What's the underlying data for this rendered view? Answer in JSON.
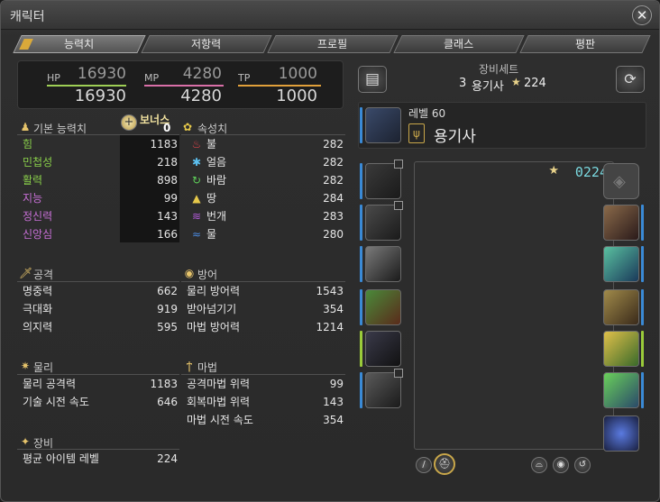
{
  "window": {
    "title": "캐릭터"
  },
  "tabs": [
    {
      "label": "능력치",
      "active": true
    },
    {
      "label": "저항력"
    },
    {
      "label": "프로필"
    },
    {
      "label": "클래스"
    },
    {
      "label": "평판"
    }
  ],
  "vitals": {
    "hp": {
      "label": "HP",
      "max": "16930",
      "current": "16930",
      "color": "#9ecf55"
    },
    "mp": {
      "label": "MP",
      "max": "4280",
      "current": "4280",
      "color": "#d96fa8"
    },
    "tp": {
      "label": "TP",
      "max": "1000",
      "current": "1000",
      "color": "#e1a03a"
    }
  },
  "base_stats": {
    "header": "기본 능력치",
    "bonus_label": "보너스",
    "bonus_value": "0",
    "items": [
      {
        "label": "힘",
        "value": "1183",
        "color": "#8ad04a"
      },
      {
        "label": "민첩성",
        "value": "218",
        "color": "#8ad04a"
      },
      {
        "label": "활력",
        "value": "898",
        "color": "#8ad04a"
      },
      {
        "label": "지능",
        "value": "99",
        "color": "#c76fd6"
      },
      {
        "label": "정신력",
        "value": "143",
        "color": "#c76fd6"
      },
      {
        "label": "신앙심",
        "value": "166",
        "color": "#c76fd6"
      }
    ]
  },
  "elements": {
    "header": "속성치",
    "items": [
      {
        "icon": "fire-icon",
        "glyph": "♨",
        "color": "#e0424a",
        "label": "불",
        "value": "282"
      },
      {
        "icon": "ice-icon",
        "glyph": "✱",
        "color": "#5cc0f0",
        "label": "얼음",
        "value": "282"
      },
      {
        "icon": "wind-icon",
        "glyph": "↻",
        "color": "#5fd05a",
        "label": "바람",
        "value": "282"
      },
      {
        "icon": "earth-icon",
        "glyph": "▲",
        "color": "#e5c84a",
        "label": "땅",
        "value": "284"
      },
      {
        "icon": "lightning-icon",
        "glyph": "≋",
        "color": "#b05ad6",
        "label": "번개",
        "value": "283"
      },
      {
        "icon": "water-icon",
        "glyph": "≈",
        "color": "#4a8ae0",
        "label": "물",
        "value": "280"
      }
    ]
  },
  "offense": {
    "header": "공격",
    "items": [
      {
        "label": "명중력",
        "value": "662"
      },
      {
        "label": "극대화",
        "value": "919"
      },
      {
        "label": "의지력",
        "value": "595"
      }
    ]
  },
  "defense": {
    "header": "방어",
    "items": [
      {
        "label": "물리 방어력",
        "value": "1543"
      },
      {
        "label": "받아넘기기",
        "value": "354"
      },
      {
        "label": "마법 방어력",
        "value": "1214"
      }
    ]
  },
  "physical": {
    "header": "물리",
    "items": [
      {
        "label": "물리 공격력",
        "value": "1183"
      },
      {
        "label": "기술 시전 속도",
        "value": "646"
      }
    ]
  },
  "magic": {
    "header": "마법",
    "items": [
      {
        "label": "공격마법 위력",
        "value": "99"
      },
      {
        "label": "회복마법 위력",
        "value": "143"
      },
      {
        "label": "마법 시전 속도",
        "value": "354"
      }
    ]
  },
  "gear": {
    "header": "장비",
    "items": [
      {
        "label": "평균 아이템 레벨",
        "value": "224"
      }
    ]
  },
  "gearset": {
    "label": "장비세트",
    "number": "3",
    "name": "용기사",
    "ilvl": "224"
  },
  "job": {
    "level_label": "레벨 60",
    "name": "용기사"
  },
  "portrait": {
    "ilvl_display": "0224"
  }
}
